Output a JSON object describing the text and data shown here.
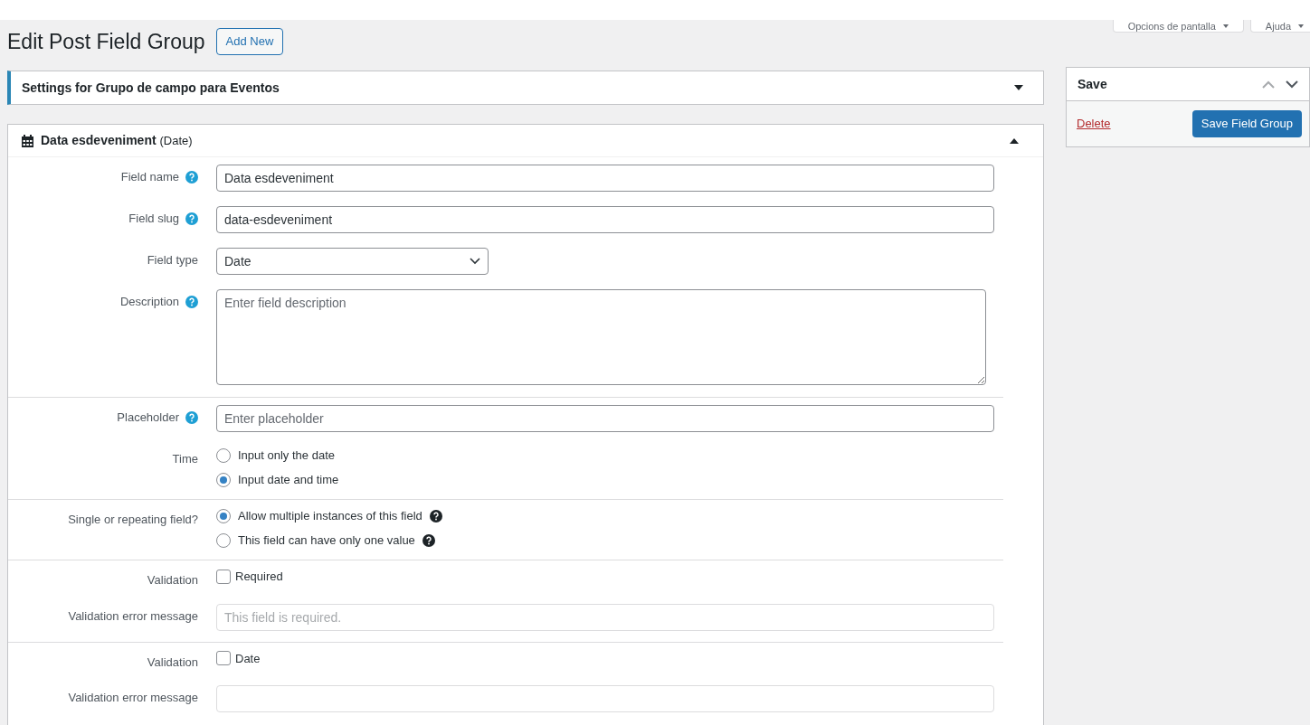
{
  "header": {
    "title": "Edit Post Field Group",
    "add_new": "Add New",
    "screen_buttons": [
      "Opcions de pantalla",
      "Ajuda"
    ]
  },
  "settings_box": {
    "title": "Settings for Grupo de campo para Eventos",
    "expanded": false
  },
  "field_box": {
    "name": "Data esdeveniment",
    "type": "(Date)",
    "expanded": true,
    "sections": [
      [
        {
          "kind": "text",
          "label": "Field name",
          "help": true,
          "value": "Data esdeveniment"
        },
        {
          "kind": "text",
          "label": "Field slug",
          "help": true,
          "value": "data-esdeveniment"
        },
        {
          "kind": "select",
          "label": "Field type",
          "help": false,
          "value": "Date"
        },
        {
          "kind": "textarea",
          "label": "Description",
          "help": true,
          "placeholder": "Enter field description"
        }
      ],
      [
        {
          "kind": "text",
          "label": "Placeholder",
          "help": true,
          "placeholder": "Enter placeholder"
        },
        {
          "kind": "radio",
          "label": "Time",
          "options": [
            {
              "label": "Input only the date",
              "selected": false,
              "help": false
            },
            {
              "label": "Input date and time",
              "selected": true,
              "help": false
            }
          ]
        }
      ],
      [
        {
          "kind": "radio",
          "label": "Single or repeating field?",
          "options": [
            {
              "label": "Allow multiple instances of this field",
              "selected": true,
              "help": true
            },
            {
              "label": "This field can have only one value",
              "selected": false,
              "help": true
            }
          ]
        }
      ],
      [
        {
          "kind": "checkbox",
          "label": "Validation",
          "option": "Required",
          "checked": false
        },
        {
          "kind": "text",
          "label": "Validation error message",
          "help": false,
          "placeholder": "This field is required.",
          "disabled": true
        }
      ],
      [
        {
          "kind": "checkbox",
          "label": "Validation",
          "option": "Date",
          "checked": false
        },
        {
          "kind": "text",
          "label": "Validation error message",
          "help": false,
          "disabled": true
        }
      ]
    ]
  },
  "save_box": {
    "title": "Save",
    "delete": "Delete",
    "save": "Save Field Group"
  }
}
